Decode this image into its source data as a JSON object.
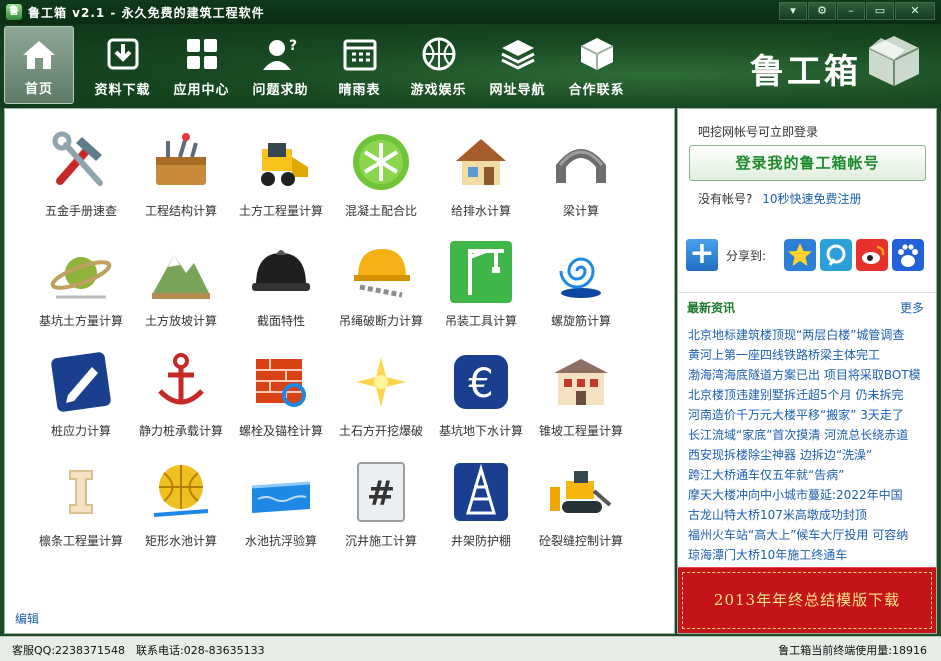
{
  "window": {
    "title": "鲁工箱 v2.1 - 永久免费的建筑工程软件",
    "controls": [
      "▾",
      "⚙",
      "–",
      "▭",
      "✕"
    ]
  },
  "nav": [
    {
      "label": "首页",
      "icon": "home-icon",
      "active": true
    },
    {
      "label": "资料下载",
      "icon": "download-icon"
    },
    {
      "label": "应用中心",
      "icon": "grid-icon"
    },
    {
      "label": "问题求助",
      "icon": "help-person-icon"
    },
    {
      "label": "晴雨表",
      "icon": "calendar-icon"
    },
    {
      "label": "游戏娱乐",
      "icon": "basketball-icon"
    },
    {
      "label": "网址导航",
      "icon": "layers-icon"
    },
    {
      "label": "合作联系",
      "icon": "cube-icon"
    }
  ],
  "brand": {
    "name": "鲁工箱"
  },
  "tools": [
    {
      "label": "五金手册速查",
      "icon": "hammer-wrench-icon"
    },
    {
      "label": "工程结构计算",
      "icon": "toolbox-icon"
    },
    {
      "label": "土方工程量计算",
      "icon": "skid-loader-icon"
    },
    {
      "label": "混凝土配合比",
      "icon": "snowflake-icon"
    },
    {
      "label": "给排水计算",
      "icon": "house-icon"
    },
    {
      "label": "梁计算",
      "icon": "arch-icon"
    },
    {
      "label": "基坑土方量计算",
      "icon": "planet-icon"
    },
    {
      "label": "土方放坡计算",
      "icon": "mountain-icon"
    },
    {
      "label": "截面特性",
      "icon": "hardhat-icon"
    },
    {
      "label": "吊绳破断力计算",
      "icon": "helmet-chain-icon"
    },
    {
      "label": "吊装工具计算",
      "icon": "crane-icon"
    },
    {
      "label": "螺旋筋计算",
      "icon": "spiral-icon"
    },
    {
      "label": "桩应力计算",
      "icon": "pencil-icon"
    },
    {
      "label": "静力桩承载计算",
      "icon": "anchor-icon"
    },
    {
      "label": "螺栓及锚栓计算",
      "icon": "firewall-icon"
    },
    {
      "label": "土石方开挖爆破",
      "icon": "sparkle-icon"
    },
    {
      "label": "基坑地下水计算",
      "icon": "euro-icon"
    },
    {
      "label": "锥坡工程量计算",
      "icon": "building-icon"
    },
    {
      "label": "檩条工程量计算",
      "icon": "beam-icon"
    },
    {
      "label": "矩形水池计算",
      "icon": "ball-icon"
    },
    {
      "label": "水池抗浮验算",
      "icon": "pool-icon"
    },
    {
      "label": "沉井施工计算",
      "icon": "hash-icon"
    },
    {
      "label": "井架防护棚",
      "icon": "tower-icon"
    },
    {
      "label": "砼裂缝控制计算",
      "icon": "bulldozer-icon"
    }
  ],
  "edit_link": "编辑",
  "side": {
    "login_hint": "吧挖网帐号可立即登录",
    "login_button": "登录我的鲁工箱帐号",
    "no_account": "没有帐号?",
    "register_link": "10秒快速免费注册",
    "share_label": "分享到:",
    "news_title": "最新资讯",
    "news_more": "更多",
    "news": [
      "北京地标建筑楼顶现“两层白楼”城管调查",
      "黄河上第一座四线铁路桥梁主体完工",
      "渤海湾海底隧道方案已出 项目将采取BOT模",
      "北京楼顶违建别墅拆迁超5个月 仍未拆完",
      "河南造价千万元大楼平移“搬家” 3天走了",
      "长江流域“家底”首次摸清 河流总长绕赤道",
      "西安现拆楼除尘神器 边拆边“洗澡”",
      "跨江大桥通车仅五年就“告病”",
      "摩天大楼冲向中小城市蔓延:2022年中国",
      "古龙山特大桥107米高墩成功封顶",
      "福州火车站“高大上”候车大厅投用 可容纳",
      "琼海潭门大桥10年施工终通车"
    ],
    "banner_text": "2013年年终总结模版下载"
  },
  "status": {
    "qq": "客服QQ:2238371548",
    "tel": "联系电话:028-83635133",
    "users": "鲁工箱当前终端使用量:18916"
  },
  "colors": {
    "title_bar": "#0b2d13",
    "toolbar": "#184a22",
    "link": "#1b5fb0",
    "login_text": "#1e8a2b",
    "banner": "#c4141a"
  }
}
